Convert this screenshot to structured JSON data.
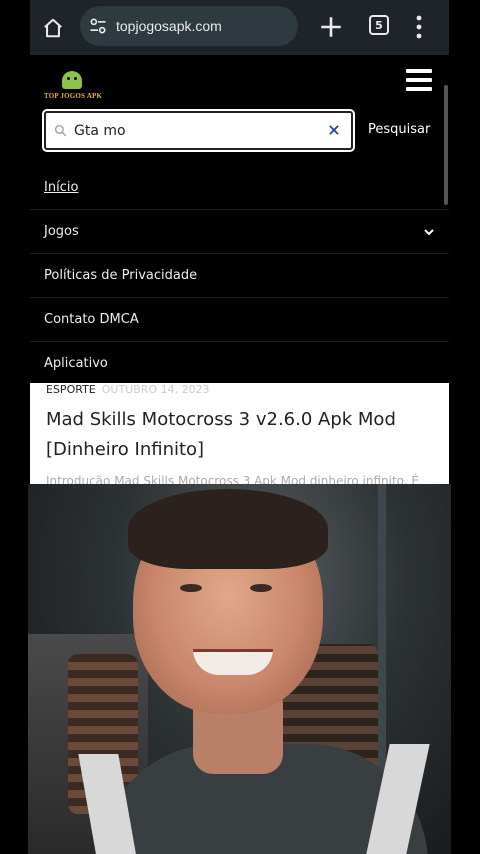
{
  "browser": {
    "url": "topjogosapk.com",
    "tab_count": "5"
  },
  "site": {
    "logo_text": "TOP JOGOS APK",
    "search": {
      "value": "Gta mo",
      "button_label": "Pesquisar"
    },
    "menu": [
      {
        "label": "Início"
      },
      {
        "label": "Jogos"
      },
      {
        "label": "Políticas de Privacidade"
      },
      {
        "label": "Contato DMCA"
      },
      {
        "label": "Aplicativo"
      }
    ]
  },
  "article": {
    "category": "ESPORTE",
    "date": "OUTUBRO 14, 2023",
    "title": "Mad Skills Motocross 3 v2.6.0 Apk Mod [Dinheiro Infinito]",
    "excerpt": "Introdução Mad Skills Motocross 3 Apk Mod dinheiro infinito. É"
  },
  "colors": {
    "logo_accent": "#e2b43d",
    "droid": "#8bc34a",
    "chrome_bg": "#1f2428"
  }
}
